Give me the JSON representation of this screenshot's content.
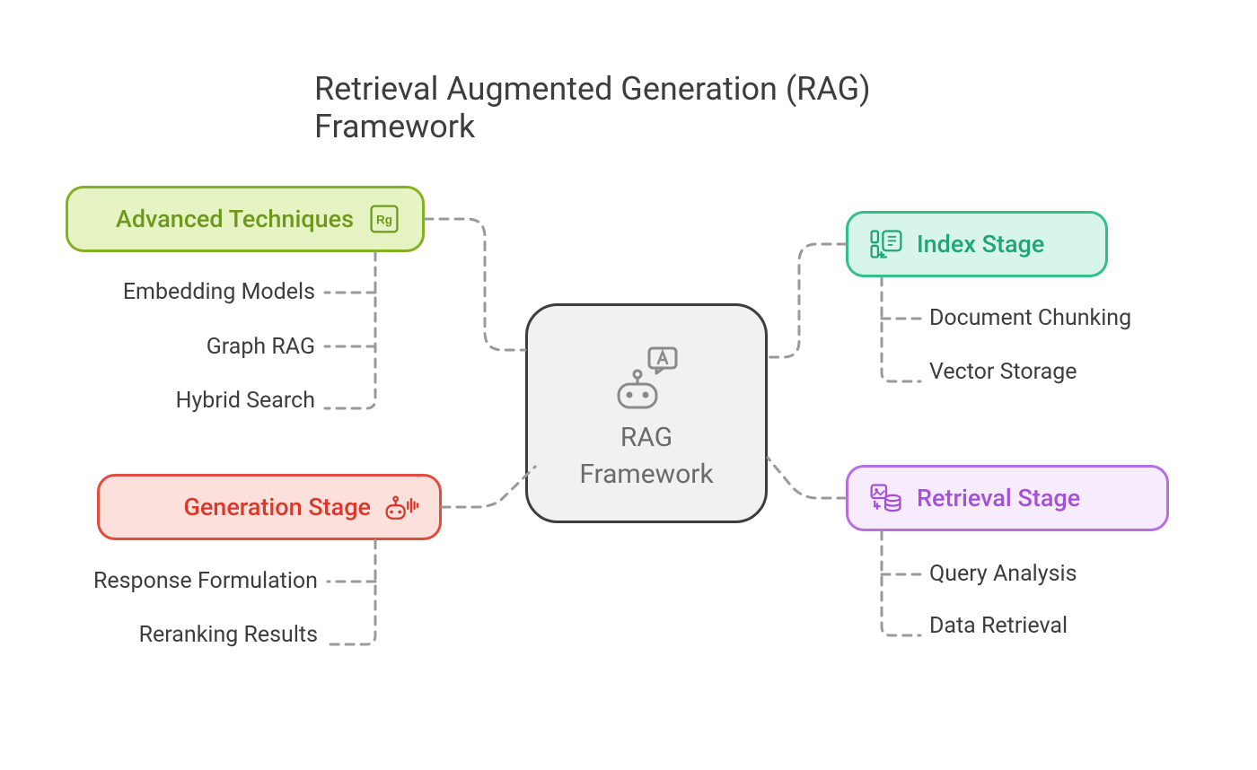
{
  "title": "Retrieval Augmented Generation (RAG) Framework",
  "center": {
    "label": "RAG\nFramework"
  },
  "nodes": {
    "advanced": {
      "label": "Advanced Techniques",
      "items": [
        "Embedding Models",
        "Graph RAG",
        "Hybrid Search"
      ]
    },
    "generation": {
      "label": "Generation Stage",
      "items": [
        "Response Formulation",
        "Reranking Results"
      ]
    },
    "index": {
      "label": "Index Stage",
      "items": [
        "Document Chunking",
        "Vector Storage"
      ]
    },
    "retrieval": {
      "label": "Retrieval Stage",
      "items": [
        "Query Analysis",
        "Data Retrieval"
      ]
    }
  }
}
